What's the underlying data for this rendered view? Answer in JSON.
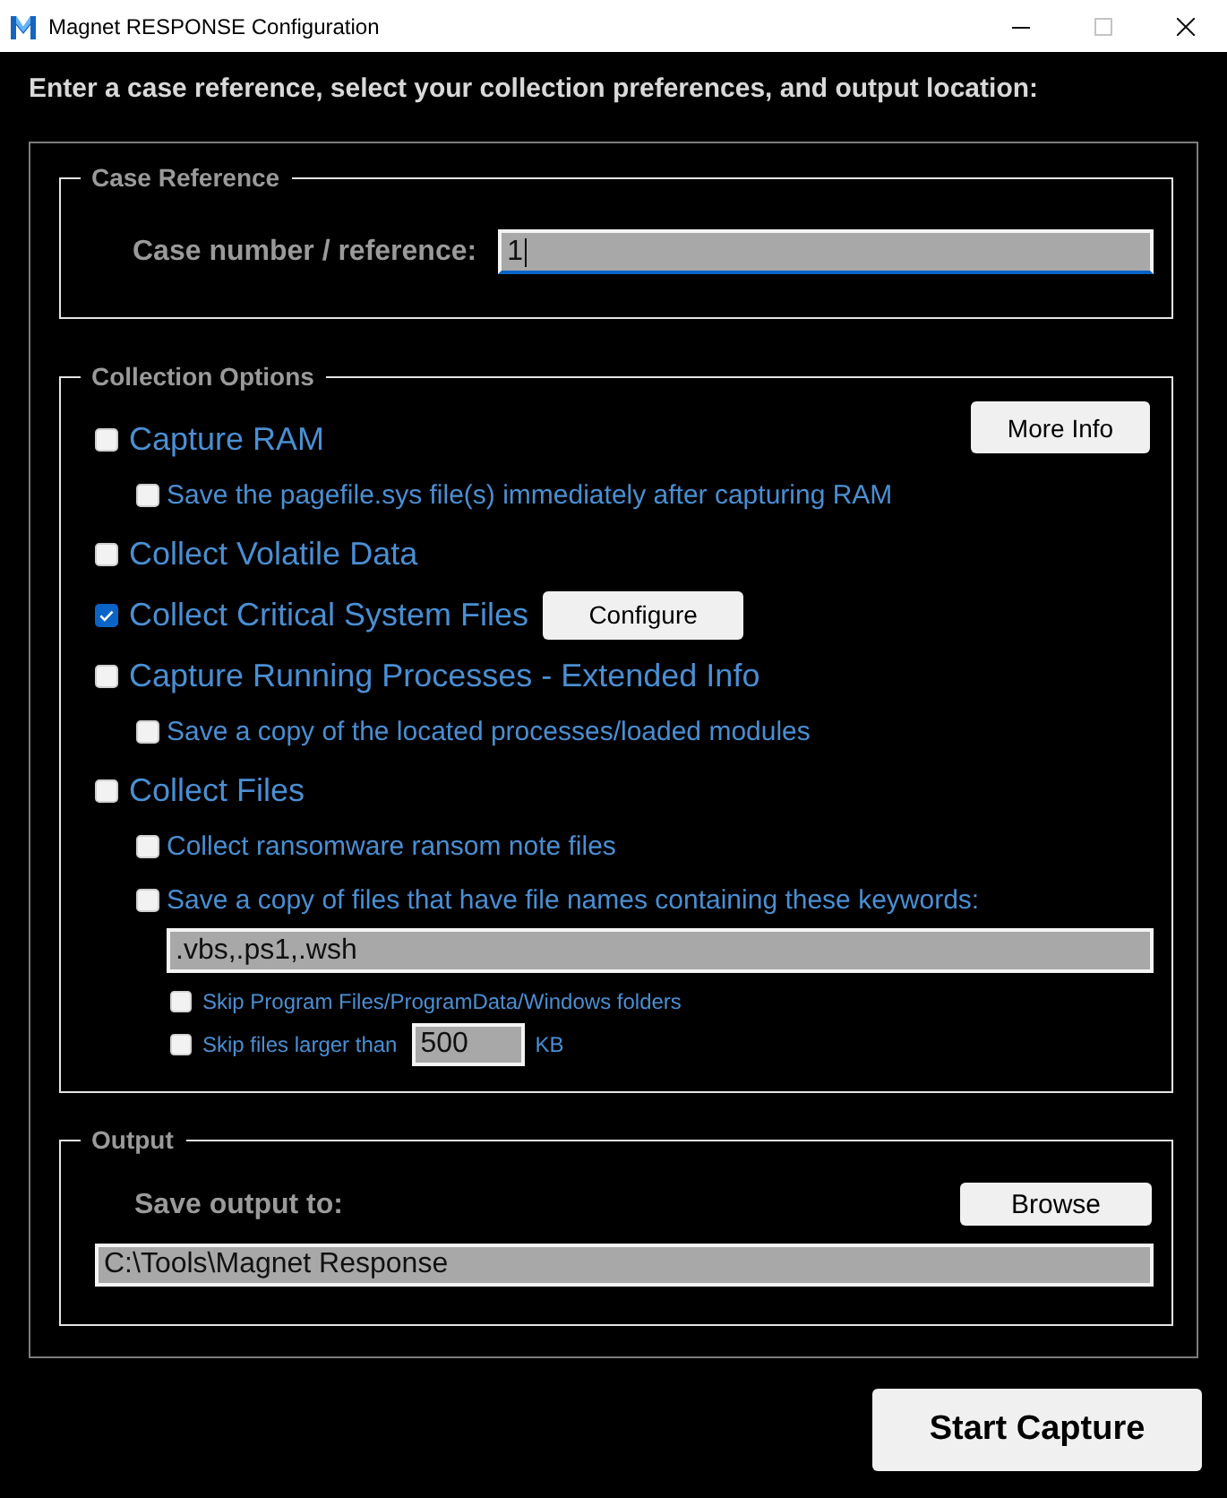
{
  "window": {
    "title": "Magnet RESPONSE Configuration",
    "controls": [
      {
        "kind": "minimize",
        "disabled": false
      },
      {
        "kind": "maximize",
        "disabled": true
      },
      {
        "kind": "close",
        "disabled": false
      }
    ]
  },
  "instructions": "Enter a case reference, select your collection preferences, and output location:",
  "case_reference": {
    "legend": "Case Reference",
    "label": "Case number / reference:",
    "value": "1",
    "focused": true
  },
  "collection_options": {
    "legend": "Collection Options",
    "more_info_button": "More Info",
    "options": [
      {
        "label": "Capture RAM",
        "checked": false,
        "children": [
          {
            "label": "Save the pagefile.sys file(s) immediately after capturing RAM",
            "checked": false
          }
        ]
      },
      {
        "label": "Collect Volatile Data",
        "checked": false
      },
      {
        "label": "Collect Critical System Files",
        "checked": true,
        "button": "Configure"
      },
      {
        "label": "Capture Running Processes - Extended Info",
        "checked": false,
        "children": [
          {
            "label": "Save a copy of the located processes/loaded modules",
            "checked": false
          }
        ]
      },
      {
        "label": "Collect Files",
        "checked": false,
        "children": [
          {
            "label": "Collect ransomware ransom note files",
            "checked": false
          },
          {
            "label": "Save a copy of files that have file names containing these keywords:",
            "checked": false,
            "keywords_field": {
              "value": ".vbs,.ps1,.wsh"
            },
            "children": [
              {
                "kind": "checkbox",
                "label": "Skip Program Files/ProgramData/Windows folders",
                "checked": false
              },
              {
                "kind": "size_limit",
                "label": "Skip files larger than",
                "checked": false,
                "value": "500",
                "unit": "KB"
              }
            ]
          }
        ]
      }
    ]
  },
  "output": {
    "legend": "Output",
    "label": "Save output to:",
    "browse_button": "Browse",
    "path": "C:\\Tools\\Magnet Response"
  },
  "start_button": "Start Capture"
}
